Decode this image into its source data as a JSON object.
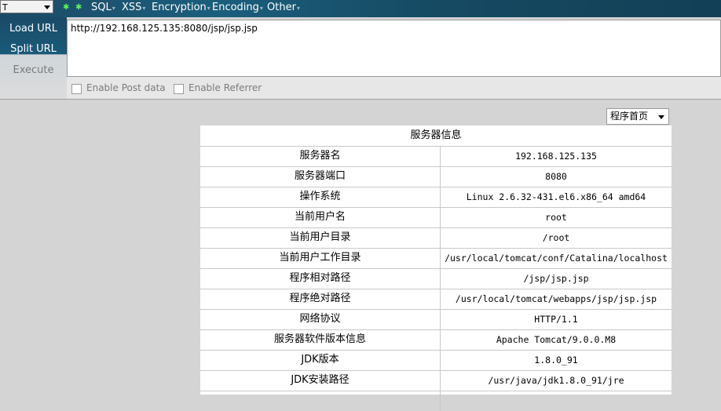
{
  "toolbar": {
    "select_value": "T",
    "menus": [
      "SQL",
      "XSS",
      "Encryption",
      "Encoding",
      "Other"
    ]
  },
  "side": {
    "load_url": "Load URL",
    "split_url": "Split URL",
    "execute": "Execute"
  },
  "url": "http://192.168.125.135:8080/jsp/jsp.jsp",
  "options": {
    "enable_post": "Enable Post data",
    "enable_referrer": "Enable Referrer"
  },
  "page_select": "程序首页",
  "server_info": {
    "title": "服务器信息",
    "rows": [
      {
        "label": "服务器名",
        "value": "192.168.125.135"
      },
      {
        "label": "服务器端口",
        "value": "8080"
      },
      {
        "label": "操作系统",
        "value": "Linux 2.6.32-431.el6.x86_64 amd64"
      },
      {
        "label": "当前用户名",
        "value": "root"
      },
      {
        "label": "当前用户目录",
        "value": "/root"
      },
      {
        "label": "当前用户工作目录",
        "value": "/usr/local/tomcat/conf/Catalina/localhost"
      },
      {
        "label": "程序相对路径",
        "value": "/jsp/jsp.jsp"
      },
      {
        "label": "程序绝对路径",
        "value": "/usr/local/tomcat/webapps/jsp/jsp.jsp"
      },
      {
        "label": "网络协议",
        "value": "HTTP/1.1"
      },
      {
        "label": "服务器软件版本信息",
        "value": "Apache Tomcat/9.0.0.M8"
      },
      {
        "label": "JDK版本",
        "value": "1.8.0_91"
      },
      {
        "label": "JDK安装路径",
        "value": "/usr/java/jdk1.8.0_91/jre"
      }
    ]
  },
  "colors": {
    "toolbar_bg": "#1b5e7c",
    "bullet_green": "#5cf25c"
  }
}
